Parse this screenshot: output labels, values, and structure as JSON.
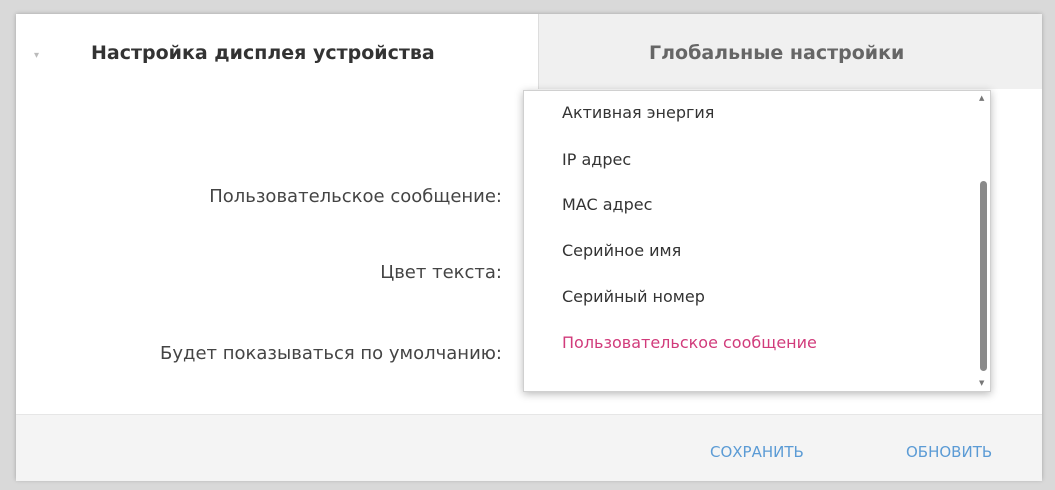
{
  "tabs": [
    {
      "label": "Настройка дисплея устройства",
      "active": true
    },
    {
      "label": "Глобальные настройки",
      "active": false
    }
  ],
  "form": {
    "custom_message_label": "Пользовательское сообщение:",
    "text_color_label": "Цвет текста:",
    "default_label": "Будет показываться по умолчанию:"
  },
  "dropdown": {
    "options": [
      "Активная энергия",
      "IP адрес",
      "MAC адрес",
      "Серийное имя",
      "Серийный номер",
      "Пользовательское сообщение"
    ],
    "selected": "Пользовательское сообщение"
  },
  "footer": {
    "save_label": "СОХРАНИТЬ",
    "refresh_label": "ОБНОВИТЬ"
  },
  "colors": {
    "accent_link": "#5b9bd5",
    "selected_option": "#d13b7b"
  },
  "icons": {
    "collapse": "chevron-icon",
    "scroll_up": "arrow-up-icon",
    "scroll_down": "arrow-down-icon"
  }
}
